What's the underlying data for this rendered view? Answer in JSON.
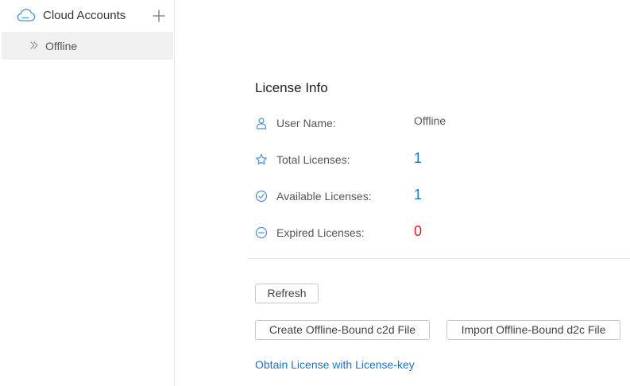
{
  "sidebar": {
    "title": "Cloud Accounts",
    "add_icon": "plus-icon",
    "cloud_icon": "cloud-icon",
    "items": [
      {
        "label": "Offline",
        "icon": "double-chevron-right-icon",
        "selected": true
      }
    ]
  },
  "license": {
    "title": "License Info",
    "rows": [
      {
        "icon": "user-icon",
        "label": "User Name:",
        "value": "Offline"
      },
      {
        "icon": "star-icon",
        "label": "Total Licenses:",
        "value": "1",
        "color": "#1a73c8"
      },
      {
        "icon": "check-circle-icon",
        "label": "Available Licenses:",
        "value": "1",
        "color": "#1a73c8"
      },
      {
        "icon": "minus-circle-icon",
        "label": "Expired Licenses:",
        "value": "0",
        "color": "#e02020"
      }
    ]
  },
  "actions": {
    "refresh_label": "Refresh",
    "create_label": "Create Offline-Bound c2d File",
    "import_label": "Import Offline-Bound d2c File",
    "obtain_link": "Obtain License with License-key"
  },
  "colors": {
    "accent": "#1a73c8",
    "icon": "#4a90d9",
    "danger": "#e02020",
    "selected_bg": "#f0f0f0"
  }
}
